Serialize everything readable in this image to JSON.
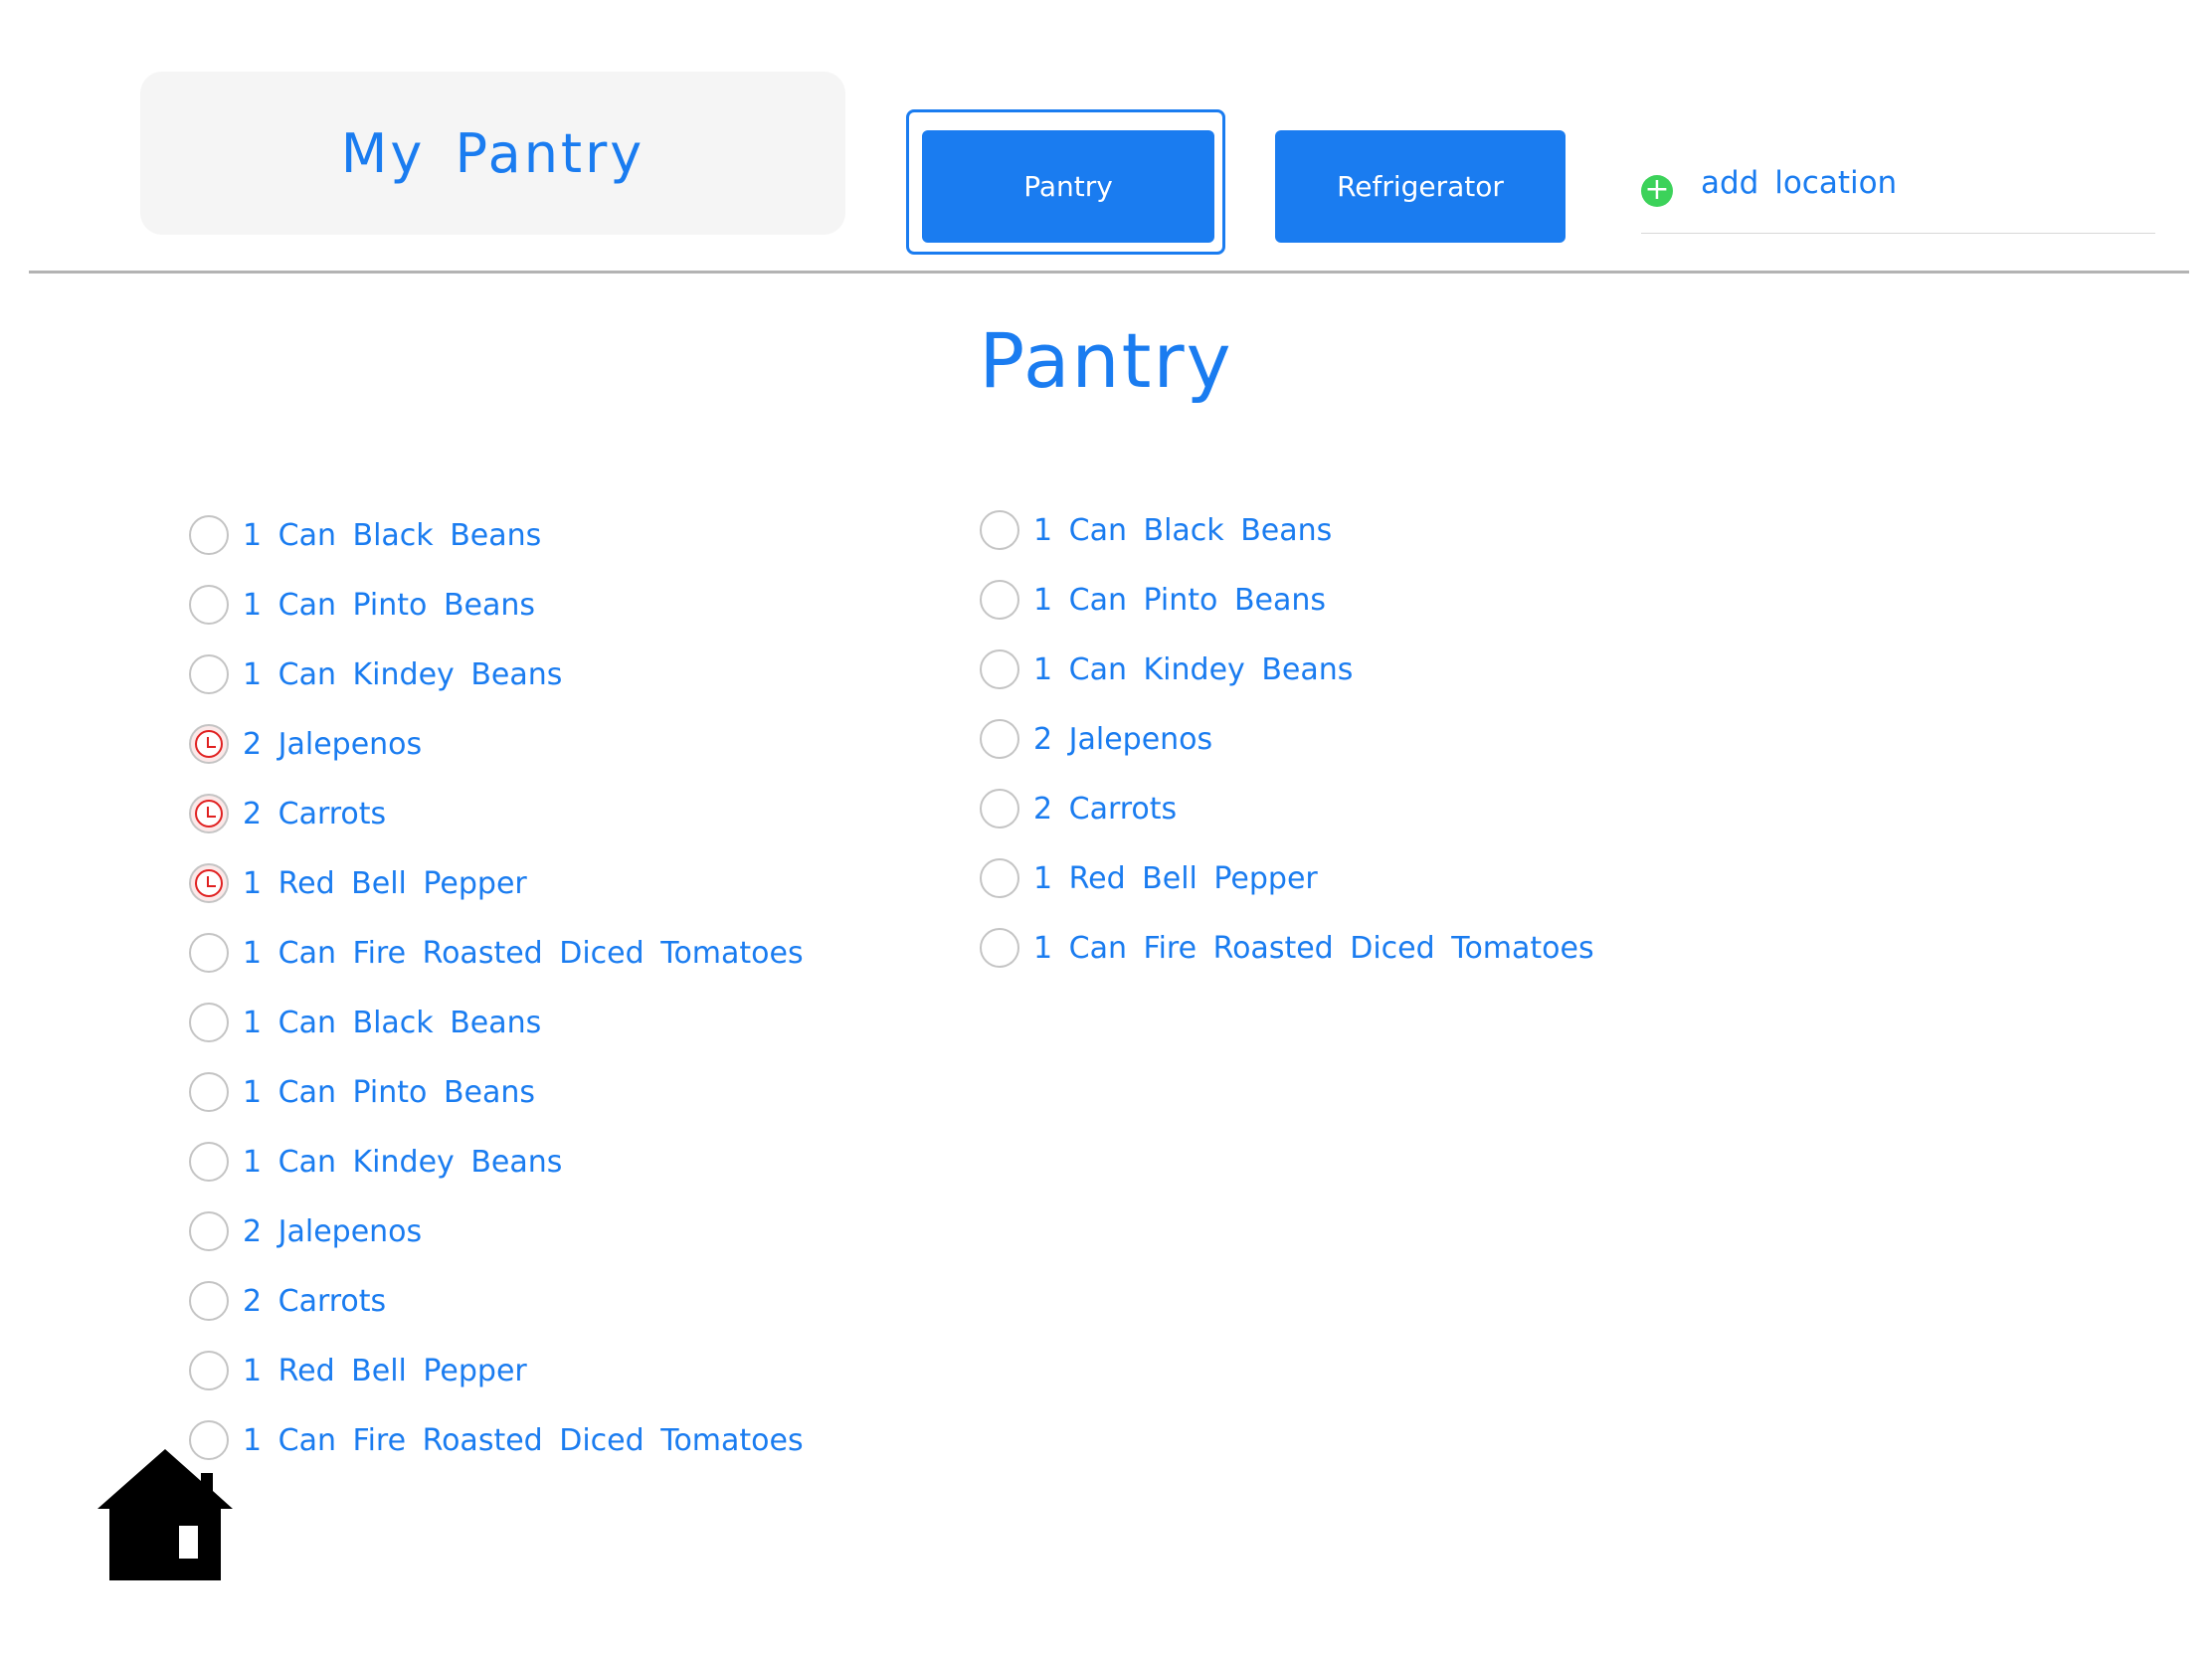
{
  "header": {
    "title": "My Pantry",
    "tabs": [
      {
        "label": "Pantry",
        "selected": true
      },
      {
        "label": "Refrigerator",
        "selected": false
      }
    ],
    "add_location_label": "add location",
    "add_icon": "plus-circle-icon"
  },
  "section_title": "Pantry",
  "colors": {
    "accent": "#1a7cf0",
    "add_icon": "#3cd25a",
    "expiring": "#e02020"
  },
  "left_list": [
    {
      "label": "1 Can Black Beans",
      "expiring": false
    },
    {
      "label": "1 Can Pinto Beans",
      "expiring": false
    },
    {
      "label": "1 Can Kindey Beans",
      "expiring": false
    },
    {
      "label": "2 Jalepenos",
      "expiring": true
    },
    {
      "label": "2 Carrots",
      "expiring": true
    },
    {
      "label": "1 Red Bell Pepper",
      "expiring": true
    },
    {
      "label": "1 Can Fire Roasted Diced Tomatoes",
      "expiring": false
    },
    {
      "label": "1 Can Black Beans",
      "expiring": false
    },
    {
      "label": "1 Can Pinto Beans",
      "expiring": false
    },
    {
      "label": "1 Can Kindey Beans",
      "expiring": false
    },
    {
      "label": "2 Jalepenos",
      "expiring": false
    },
    {
      "label": "2 Carrots",
      "expiring": false
    },
    {
      "label": "1 Red Bell Pepper",
      "expiring": false
    },
    {
      "label": "1 Can Fire Roasted Diced Tomatoes",
      "expiring": false
    }
  ],
  "right_list": [
    {
      "label": "1 Can Black Beans",
      "expiring": false
    },
    {
      "label": "1 Can Pinto Beans",
      "expiring": false
    },
    {
      "label": "1 Can Kindey Beans",
      "expiring": false
    },
    {
      "label": "2 Jalepenos",
      "expiring": false
    },
    {
      "label": "2 Carrots",
      "expiring": false
    },
    {
      "label": "1 Red Bell Pepper",
      "expiring": false
    },
    {
      "label": "1 Can Fire Roasted Diced Tomatoes",
      "expiring": false
    }
  ],
  "footer": {
    "home_icon": "home-icon"
  }
}
